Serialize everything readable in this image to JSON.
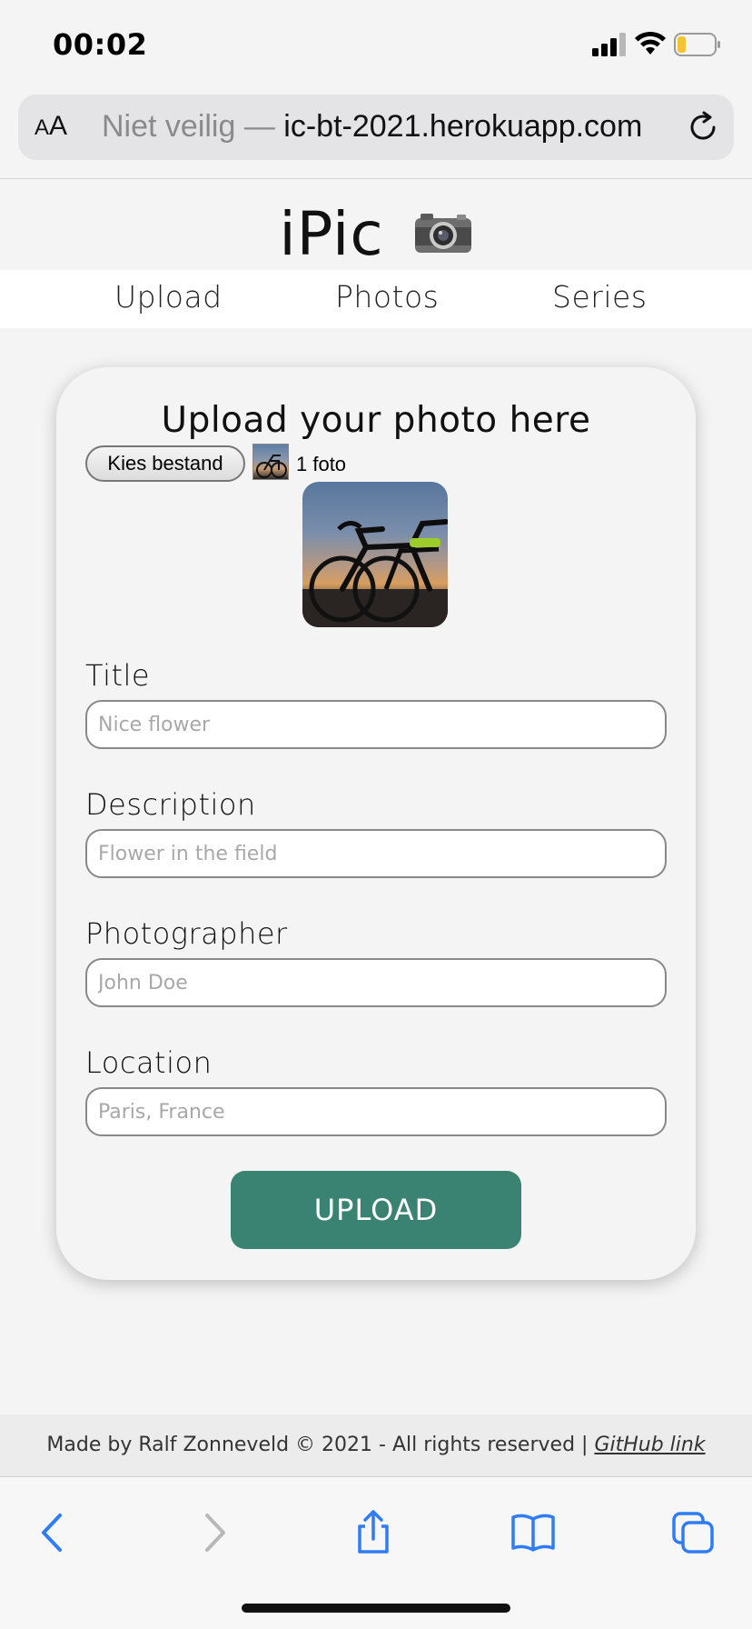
{
  "status_bar": {
    "time": "00:02",
    "icons": [
      "cellular-signal-icon",
      "wifi-icon",
      "battery-icon"
    ]
  },
  "browser": {
    "aa_label_small": "A",
    "aa_label_large": "A",
    "url_insecure": "Niet veilig — ",
    "url_domain": "ic-bt-2021.herokuapp.com",
    "reload_icon": "reload-icon"
  },
  "site": {
    "title": "iPic",
    "title_icon": "camera-icon",
    "nav": [
      {
        "label": "Upload"
      },
      {
        "label": "Photos"
      },
      {
        "label": "Series"
      }
    ]
  },
  "form": {
    "heading": "Upload your photo here",
    "file_button": "Kies bestand",
    "file_count": "1 foto",
    "fields": [
      {
        "label": "Title",
        "placeholder": "Nice flower"
      },
      {
        "label": "Description",
        "placeholder": "Flower in the field"
      },
      {
        "label": "Photographer",
        "placeholder": "John Doe"
      },
      {
        "label": "Location",
        "placeholder": "Paris, France"
      }
    ],
    "submit_label": "UPLOAD",
    "accent_color": "#3a8272"
  },
  "footer": {
    "text": "Made by Ralf Zonneveld © 2021 - All rights reserved | ",
    "link": "GitHub link"
  },
  "toolbar": {
    "icons": [
      "back-icon",
      "forward-icon",
      "share-icon",
      "bookmarks-icon",
      "tabs-icon"
    ]
  }
}
